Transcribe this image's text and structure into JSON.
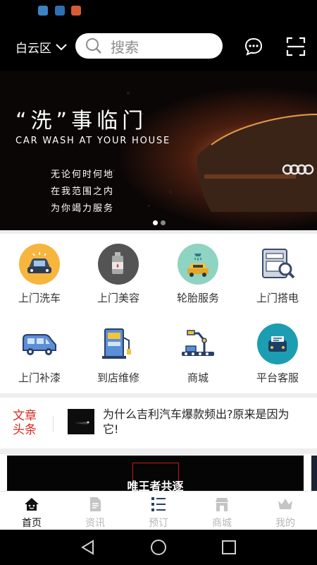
{
  "header": {
    "district": "白云区",
    "search_placeholder": "搜索"
  },
  "banner": {
    "title": "“洗”事临门",
    "subtitle": "CAR WASH AT YOUR HOUSE",
    "lines": [
      "无论何时何地",
      "在我范围之内",
      "为你竭力服务"
    ],
    "slide_count": 2,
    "active_slide": 1
  },
  "services": [
    {
      "label": "上门洗车",
      "icon": "car-wash-icon"
    },
    {
      "label": "上门美容",
      "icon": "beauty-bottle-icon"
    },
    {
      "label": "轮胎服务",
      "icon": "tire-service-icon"
    },
    {
      "label": "上门搭电",
      "icon": "battery-jump-icon"
    },
    {
      "label": "上门补漆",
      "icon": "paint-van-icon"
    },
    {
      "label": "到店维修",
      "icon": "repair-station-icon"
    },
    {
      "label": "商城",
      "icon": "mall-robot-icon"
    },
    {
      "label": "平台客服",
      "icon": "customer-service-icon"
    }
  ],
  "news": {
    "tag": "文章头条",
    "headline": "为什么吉利汽车爆款频出?原来是因为它!"
  },
  "promo": {
    "title": "唯王者共逐"
  },
  "tabs": [
    {
      "label": "首页",
      "icon": "home-icon",
      "active": true
    },
    {
      "label": "资讯",
      "icon": "document-icon",
      "active": false
    },
    {
      "label": "预订",
      "icon": "list-icon",
      "active": false
    },
    {
      "label": "商城",
      "icon": "store-icon",
      "active": false
    },
    {
      "label": "我的",
      "icon": "crown-icon",
      "active": false
    }
  ],
  "colors": {
    "accent_red": "#d62a1e",
    "header_bg": "#000000",
    "tab_active": "#111111",
    "tab_inactive": "#b8b8b8"
  }
}
